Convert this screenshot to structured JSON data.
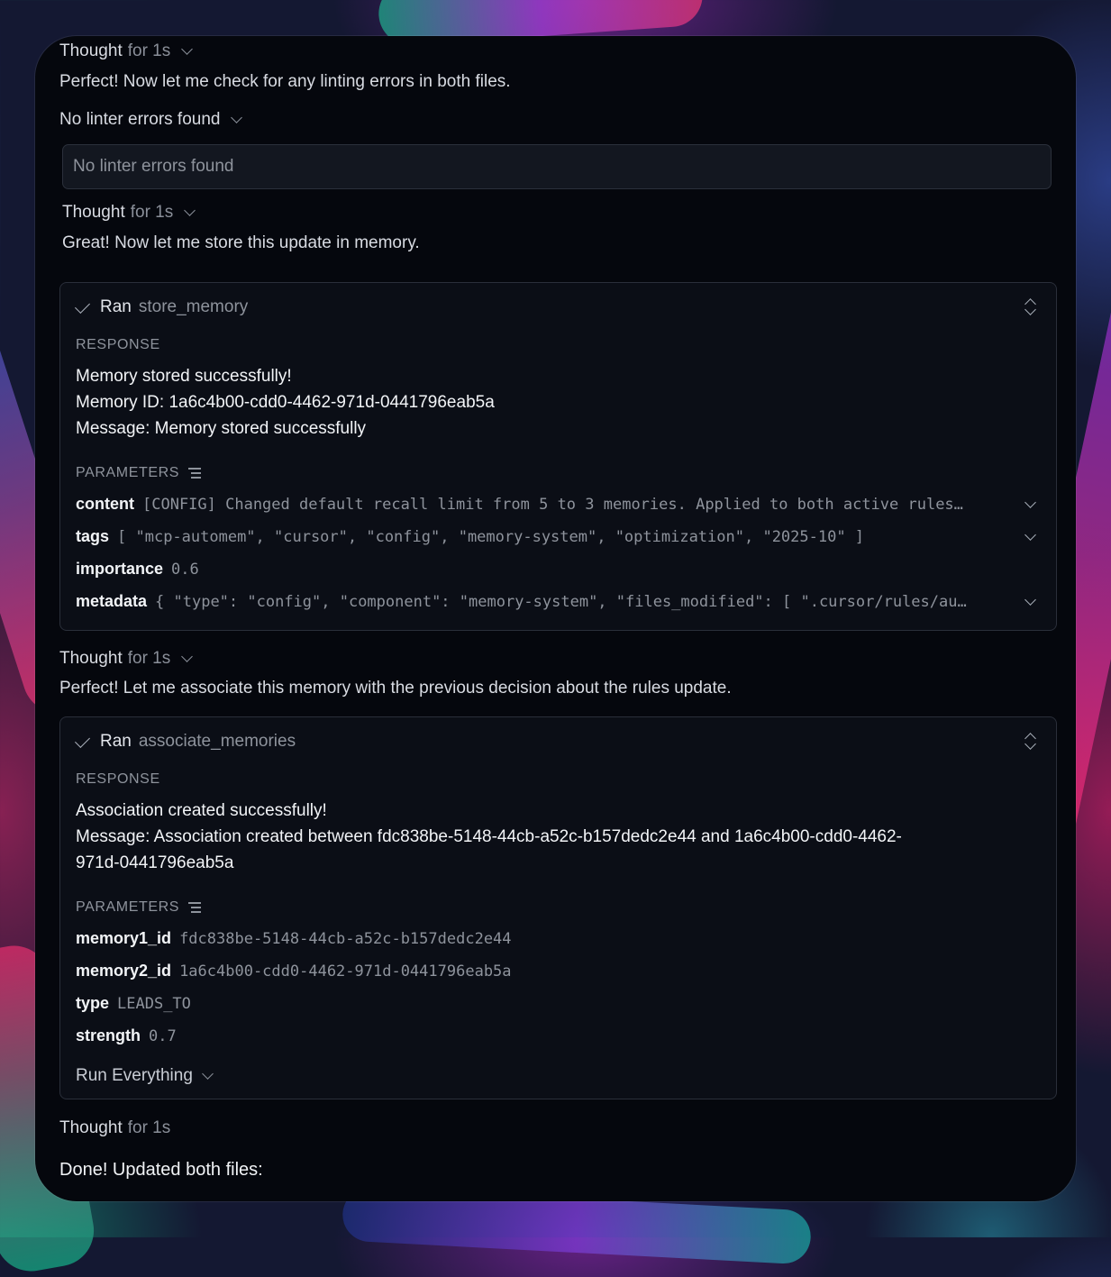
{
  "thought1": {
    "label": "Thought",
    "duration": "for 1s"
  },
  "msg1": "Perfect! Now let me check for any linting errors in both files.",
  "lint": {
    "label": "No linter errors found",
    "box_text": "No linter errors found"
  },
  "thought2": {
    "label": "Thought",
    "duration": "for 1s"
  },
  "msg2": "Great! Now let me store this update in memory.",
  "card1": {
    "ran": "Ran",
    "tool": "store_memory",
    "response_label": "RESPONSE",
    "response_lines": [
      "Memory stored successfully!",
      "Memory ID: 1a6c4b00-cdd0-4462-971d-0441796eab5a",
      "Message: Memory stored successfully"
    ],
    "parameters_label": "PARAMETERS",
    "params": [
      {
        "key": "content",
        "value": "[CONFIG] Changed default recall limit from 5 to 3 memories. Applied to both active rules…"
      },
      {
        "key": "tags",
        "value": "[ \"mcp-automem\", \"cursor\", \"config\", \"memory-system\", \"optimization\", \"2025-10\" ]"
      },
      {
        "key": "importance",
        "value": "0.6"
      },
      {
        "key": "metadata",
        "value": "{ \"type\": \"config\", \"component\": \"memory-system\", \"files_modified\": [ \".cursor/rules/au…"
      }
    ]
  },
  "thought3": {
    "label": "Thought",
    "duration": "for 1s"
  },
  "msg3": "Perfect! Let me associate this memory with the previous decision about the rules update.",
  "card2": {
    "ran": "Ran",
    "tool": "associate_memories",
    "response_label": "RESPONSE",
    "response_lines": [
      "Association created successfully!",
      "Message: Association created between fdc838be-5148-44cb-a52c-b157dedc2e44 and 1a6c4b00-cdd0-4462-",
      "971d-0441796eab5a"
    ],
    "parameters_label": "PARAMETERS",
    "params": [
      {
        "key": "memory1_id",
        "value": "fdc838be-5148-44cb-a52c-b157dedc2e44"
      },
      {
        "key": "memory2_id",
        "value": "1a6c4b00-cdd0-4462-971d-0441796eab5a"
      },
      {
        "key": "type",
        "value": "LEADS_TO"
      },
      {
        "key": "strength",
        "value": "0.7"
      }
    ],
    "run_label": "Run Everything"
  },
  "thought4": {
    "label": "Thought",
    "duration": "for 1s"
  },
  "done": "Done! Updated both files:"
}
